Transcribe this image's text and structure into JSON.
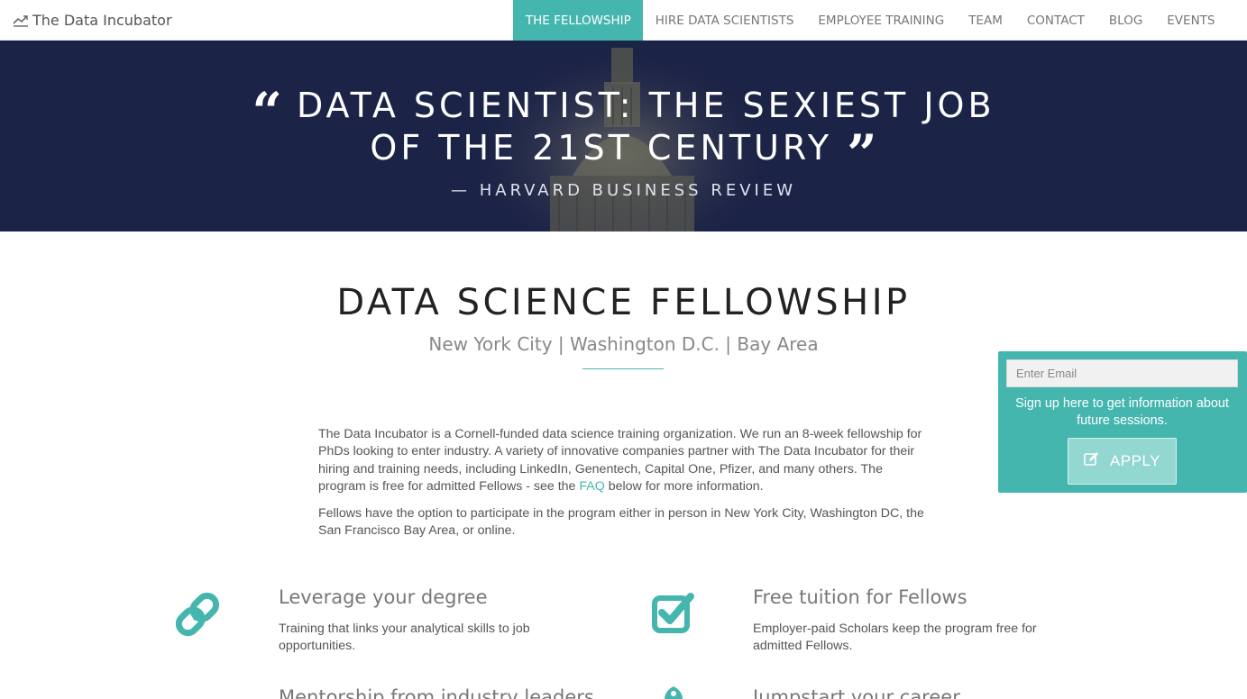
{
  "brand": {
    "name": "The Data Incubator",
    "icon": "line-chart-icon"
  },
  "nav": {
    "items": [
      {
        "label": "THE FELLOWSHIP",
        "active": true
      },
      {
        "label": "HIRE DATA SCIENTISTS",
        "active": false
      },
      {
        "label": "EMPLOYEE TRAINING",
        "active": false
      },
      {
        "label": "TEAM",
        "active": false
      },
      {
        "label": "CONTACT",
        "active": false
      },
      {
        "label": "BLOG",
        "active": false
      },
      {
        "label": "EVENTS",
        "active": false
      }
    ]
  },
  "hero": {
    "open_quote": "“",
    "quote_line1": "DATA SCIENTIST: THE SEXIEST JOB",
    "quote_line2": "OF THE 21ST CENTURY",
    "close_quote": "”",
    "source": "— HARVARD BUSINESS REVIEW"
  },
  "main": {
    "title": "DATA SCIENCE FELLOWSHIP",
    "subtitle": "New York City | Washington D.C. | Bay Area",
    "intro_p1_before": "The Data Incubator is a Cornell-funded data science training organization. We run an 8-week fellowship for PhDs looking to enter industry. A variety of innovative companies partner with The Data Incubator for their hiring and training needs, including LinkedIn, Genentech, Capital One, Pfizer, and many others. The program is free for admitted Fellows - see the ",
    "intro_p1_link": "FAQ",
    "intro_p1_after": " below for more information.",
    "intro_p2": "Fellows have the option to participate in the program either in person in New York City, Washington DC, the San Francisco Bay Area, or online."
  },
  "features": [
    {
      "icon": "link-icon",
      "title": "Leverage your degree",
      "desc": "Training that links your analytical skills to job opportunities."
    },
    {
      "icon": "checkbox-icon",
      "title": "Free tuition for Fellows",
      "desc": "Employer-paid Scholars keep the program free for admitted Fellows."
    },
    {
      "icon": "users-icon",
      "title": "Mentorship from industry leaders",
      "desc": ""
    },
    {
      "icon": "rocket-icon",
      "title": "Jumpstart your career",
      "desc": ""
    }
  ],
  "signup": {
    "email_placeholder": "Enter Email",
    "text": "Sign up here to get information about future sessions.",
    "apply_label": "APPLY"
  },
  "colors": {
    "accent": "#45b6ae",
    "hero_bg": "#1b2346"
  }
}
